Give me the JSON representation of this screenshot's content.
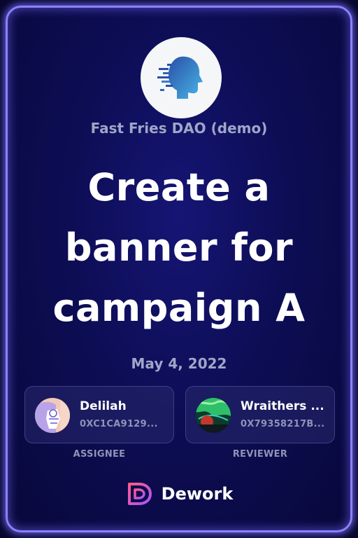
{
  "org": {
    "name": "Fast Fries DAO (demo)",
    "logo_icon": "face-profile-icon"
  },
  "task": {
    "title_lines": [
      "Create a",
      "banner for",
      "campaign A"
    ],
    "date": "May 4, 2022"
  },
  "assignee": {
    "name": "Delilah",
    "address": "0XC1CA9129...",
    "role": "ASSIGNEE"
  },
  "reviewer": {
    "name": "Wraithers ...",
    "address": "0X79358217B...",
    "role": "REVIEWER"
  },
  "brand": {
    "name": "Dework",
    "icon": "dework-logo-icon"
  },
  "colors": {
    "background": "#0d0d55",
    "glow_border": "#8b82ff",
    "accent": "#e83e8c"
  }
}
